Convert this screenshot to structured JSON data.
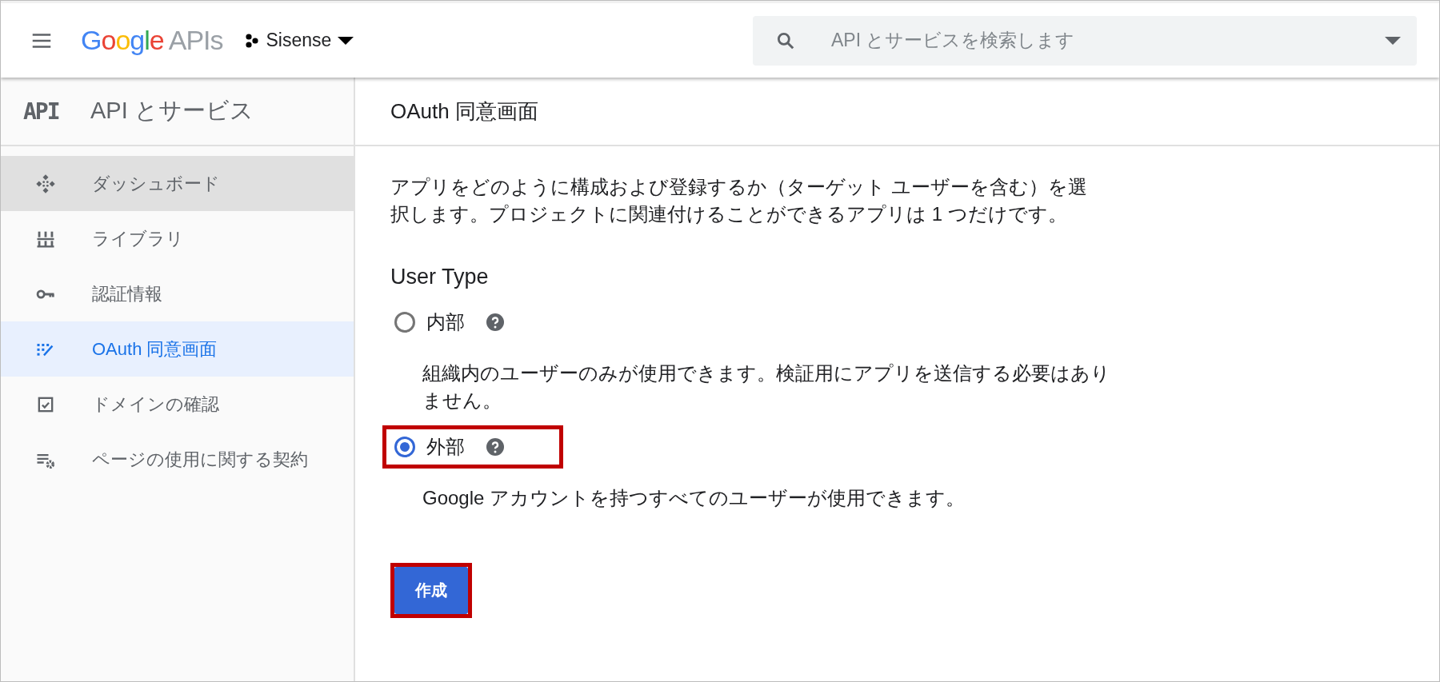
{
  "header": {
    "logo_letters": [
      {
        "text": "G",
        "color": "#4285f4"
      },
      {
        "text": "o",
        "color": "#ea4335"
      },
      {
        "text": "o",
        "color": "#fbbc05"
      },
      {
        "text": "g",
        "color": "#4285f4"
      },
      {
        "text": "l",
        "color": "#34a853"
      },
      {
        "text": "e",
        "color": "#ea4335"
      }
    ],
    "logo_suffix": "APIs",
    "project": "Sisense",
    "search": {
      "placeholder": "API とサービスを検索します"
    }
  },
  "sidebar": {
    "badge": "API",
    "title": "API とサービス",
    "items": [
      {
        "kind": "dashboard",
        "label": "ダッシュボード",
        "selected": false,
        "hovered": true
      },
      {
        "kind": "library",
        "label": "ライブラリ",
        "selected": false,
        "hovered": false
      },
      {
        "kind": "key",
        "label": "認証情報",
        "selected": false,
        "hovered": false
      },
      {
        "kind": "consent",
        "label": "OAuth 同意画面",
        "selected": true,
        "hovered": false
      },
      {
        "kind": "domain",
        "label": "ドメインの確認",
        "selected": false,
        "hovered": false
      },
      {
        "kind": "terms",
        "label": "ページの使用に関する契約",
        "selected": false,
        "hovered": false
      }
    ]
  },
  "page": {
    "title": "OAuth 同意画面",
    "intro": "アプリをどのように構成および登録するか（ターゲット ユーザーを含む）を選択します。プロジェクトに関連付けることができるアプリは 1 つだけです。",
    "section_title": "User Type",
    "options": [
      {
        "label": "内部",
        "selected": false,
        "annotated": false,
        "description": "組織内のユーザーのみが使用できます。検証用にアプリを送信する必要はありません。"
      },
      {
        "label": "外部",
        "selected": true,
        "annotated": true,
        "description": "Google アカウントを持つすべてのユーザーが使用できます。"
      }
    ],
    "create_button": {
      "label": "作成",
      "annotated": true
    }
  }
}
